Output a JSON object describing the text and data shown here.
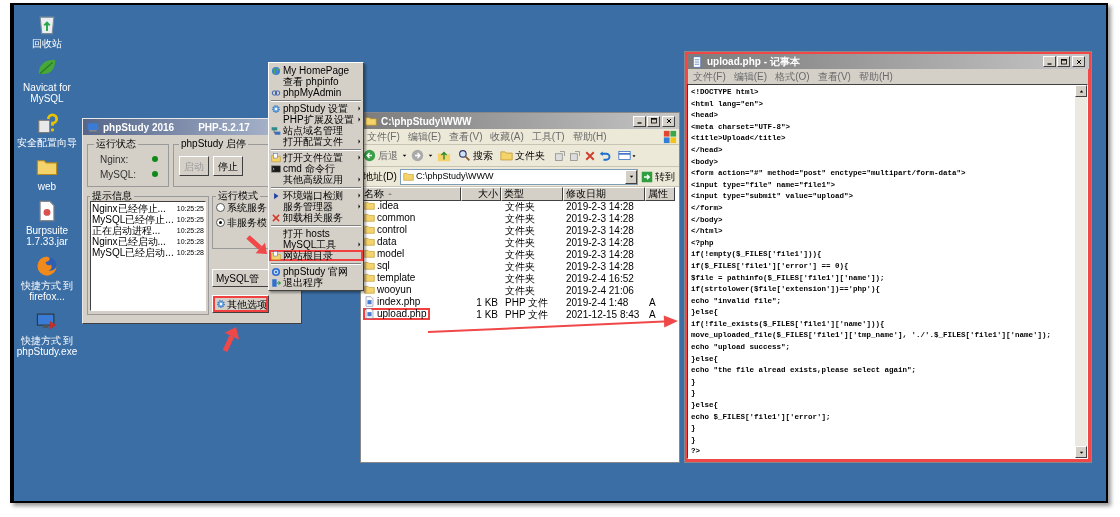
{
  "desktop_icons": [
    {
      "label": "回收站"
    },
    {
      "label": "Navicat for MySQL"
    },
    {
      "label": "安全配置向导"
    },
    {
      "label": "web"
    },
    {
      "label": "Burpsuite 1.7.33.jar"
    },
    {
      "label": "快捷方式 到 firefox..."
    },
    {
      "label": "快捷方式 到 phpStudy.exe"
    }
  ],
  "phpstudy_window": {
    "title": "phpStudy 2016",
    "version": "PHP-5.2.17",
    "status_group": {
      "title": "运行状态",
      "services": [
        {
          "name": "Nginx:",
          "running": true
        },
        {
          "name": "MySQL:",
          "running": true
        }
      ]
    },
    "control_group": {
      "title": "phpStudy 启停",
      "buttons": [
        {
          "label": "启动",
          "disabled": true
        },
        {
          "label": "停止",
          "disabled": false
        }
      ]
    },
    "log_group": {
      "title": "提示信息",
      "entries": [
        {
          "message": "Nginx已经停止...",
          "time": "10:25:25"
        },
        {
          "message": "MySQL已经停止...",
          "time": "10:25:25"
        },
        {
          "message": "正在启动进程...",
          "time": "10:25:28"
        },
        {
          "message": "Nginx已经启动...",
          "time": "10:25:28"
        },
        {
          "message": "MySQL已经启动...",
          "time": "10:25:28"
        }
      ]
    },
    "mode_group": {
      "title": "运行模式",
      "options": [
        {
          "label": "系统服务",
          "selected": false
        },
        {
          "label": "非服务模",
          "selected": true
        }
      ]
    },
    "buttons": [
      {
        "label": "MySQL管",
        "highlighted": false
      },
      {
        "label": "其他选项",
        "highlighted": true
      }
    ]
  },
  "context_menu": {
    "items": [
      {
        "kind": "item",
        "label": "My HomePage",
        "submenu": false,
        "highlighted": false
      },
      {
        "kind": "item",
        "label": "查看 phpinfo",
        "submenu": false,
        "highlighted": false
      },
      {
        "kind": "item",
        "label": "phpMyAdmin",
        "submenu": false,
        "highlighted": false
      },
      {
        "kind": "separator"
      },
      {
        "kind": "item",
        "label": "phpStudy 设置",
        "submenu": true,
        "highlighted": false
      },
      {
        "kind": "item",
        "label": "PHP扩展及设置",
        "submenu": true,
        "highlighted": false
      },
      {
        "kind": "item",
        "label": "站点域名管理",
        "submenu": false,
        "highlighted": false
      },
      {
        "kind": "item",
        "label": "打开配置文件",
        "submenu": true,
        "highlighted": false
      },
      {
        "kind": "separator"
      },
      {
        "kind": "item",
        "label": "打开文件位置",
        "submenu": true,
        "highlighted": false
      },
      {
        "kind": "item",
        "label": "cmd 命令行",
        "submenu": false,
        "highlighted": false
      },
      {
        "kind": "item",
        "label": "其他高级应用",
        "submenu": true,
        "highlighted": false
      },
      {
        "kind": "separator"
      },
      {
        "kind": "item",
        "label": "环境端口检测",
        "submenu": true,
        "highlighted": false
      },
      {
        "kind": "item",
        "label": "服务管理器",
        "submenu": true,
        "highlighted": false
      },
      {
        "kind": "item",
        "label": "卸载相关服务",
        "submenu": false,
        "highlighted": false
      },
      {
        "kind": "separator"
      },
      {
        "kind": "item",
        "label": "打开 hosts",
        "submenu": false,
        "highlighted": false
      },
      {
        "kind": "item",
        "label": "MySQL工具",
        "submenu": true,
        "highlighted": false
      },
      {
        "kind": "item",
        "label": "网站根目录",
        "submenu": false,
        "highlighted": true
      },
      {
        "kind": "separator"
      },
      {
        "kind": "item",
        "label": "phpStudy 官网",
        "submenu": false,
        "highlighted": false
      },
      {
        "kind": "item",
        "label": "退出程序",
        "submenu": false,
        "highlighted": false
      }
    ]
  },
  "explorer_window": {
    "title": "C:\\phpStudy\\WWW",
    "menu": [
      "文件(F)",
      "编辑(E)",
      "查看(V)",
      "收藏(A)",
      "工具(T)",
      "帮助(H)"
    ],
    "toolbar": {
      "back": "后退",
      "search": "搜索",
      "folders": "文件夹"
    },
    "address": {
      "label": "地址(D)",
      "value": "C:\\phpStudy\\WWW",
      "go": "转到"
    },
    "columns": [
      "名称",
      "大小",
      "类型",
      "修改日期",
      "属性"
    ],
    "rows": [
      {
        "kind": "folder",
        "name": ".idea",
        "size": "",
        "type": "文件夹",
        "modified": "2019-2-3 14:28",
        "attributes": "",
        "highlighted": false
      },
      {
        "kind": "folder",
        "name": "common",
        "type": "文件夹",
        "modified": "2019-2-3 14:28",
        "highlighted": false
      },
      {
        "kind": "folder",
        "name": "control",
        "type": "文件夹",
        "modified": "2019-2-3 14:28",
        "highlighted": false
      },
      {
        "kind": "folder",
        "name": "data",
        "type": "文件夹",
        "modified": "2019-2-3 14:28",
        "highlighted": false
      },
      {
        "kind": "folder",
        "name": "model",
        "type": "文件夹",
        "modified": "2019-2-3 14:28",
        "highlighted": false
      },
      {
        "kind": "folder",
        "name": "sql",
        "type": "文件夹",
        "modified": "2019-2-3 14:28",
        "highlighted": false
      },
      {
        "kind": "folder",
        "name": "template",
        "type": "文件夹",
        "modified": "2019-2-4 16:52",
        "highlighted": false
      },
      {
        "kind": "folder",
        "name": "wooyun",
        "type": "文件夹",
        "modified": "2019-2-4 21:06",
        "highlighted": false
      },
      {
        "kind": "file",
        "name": "index.php",
        "size": "1 KB",
        "type": "PHP 文件",
        "modified": "2019-2-4 1:48",
        "attributes": "A",
        "highlighted": false
      },
      {
        "kind": "file",
        "name": "upload.php",
        "size": "1 KB",
        "type": "PHP 文件",
        "modified": "2021-12-15 8:43",
        "attributes": "A",
        "highlighted": true
      }
    ]
  },
  "notepad_window": {
    "title": "upload.php - 记事本",
    "highlighted": true,
    "menu": [
      "文件(F)",
      "编辑(E)",
      "格式(O)",
      "查看(V)",
      "帮助(H)"
    ],
    "lines": [
      "<!DOCTYPE html>",
      "<html lang=\"en\">",
      "<head>",
      "<meta charset=\"UTF-8\">",
      "<title>Upload</title>",
      "</head>",
      "<body>",
      "<form action=\"#\" method=\"post\" enctype=\"multipart/form-data\">",
      "<input type=\"file\" name=\"file1\">",
      "<input type=\"submit\" value=\"upload\">",
      "</form>",
      "</body>",
      "</html>",
      "<?php",
      "if(!empty($_FILES['file1'])){",
      "if($_FILES['file1']['error'] == 0){",
      "$file = pathinfo($_FILES['file1']['name']);",
      "if(strtolower($file['extension'])=='php'){",
      "echo \"invalid file\";",
      "}else{",
      "if(!file_exists($_FILES['file1']['name'])){",
      "move_uploaded_file($_FILES['file1']['tmp_name'], './'.$_FILES['file1']['name']);",
      "echo \"upload success\";",
      "}else{",
      "echo \"the file alread exists,please select again\";",
      "}",
      "}",
      "}else{",
      "echo $_FILES['file1']['error'];",
      "}",
      "}",
      "?>"
    ]
  }
}
